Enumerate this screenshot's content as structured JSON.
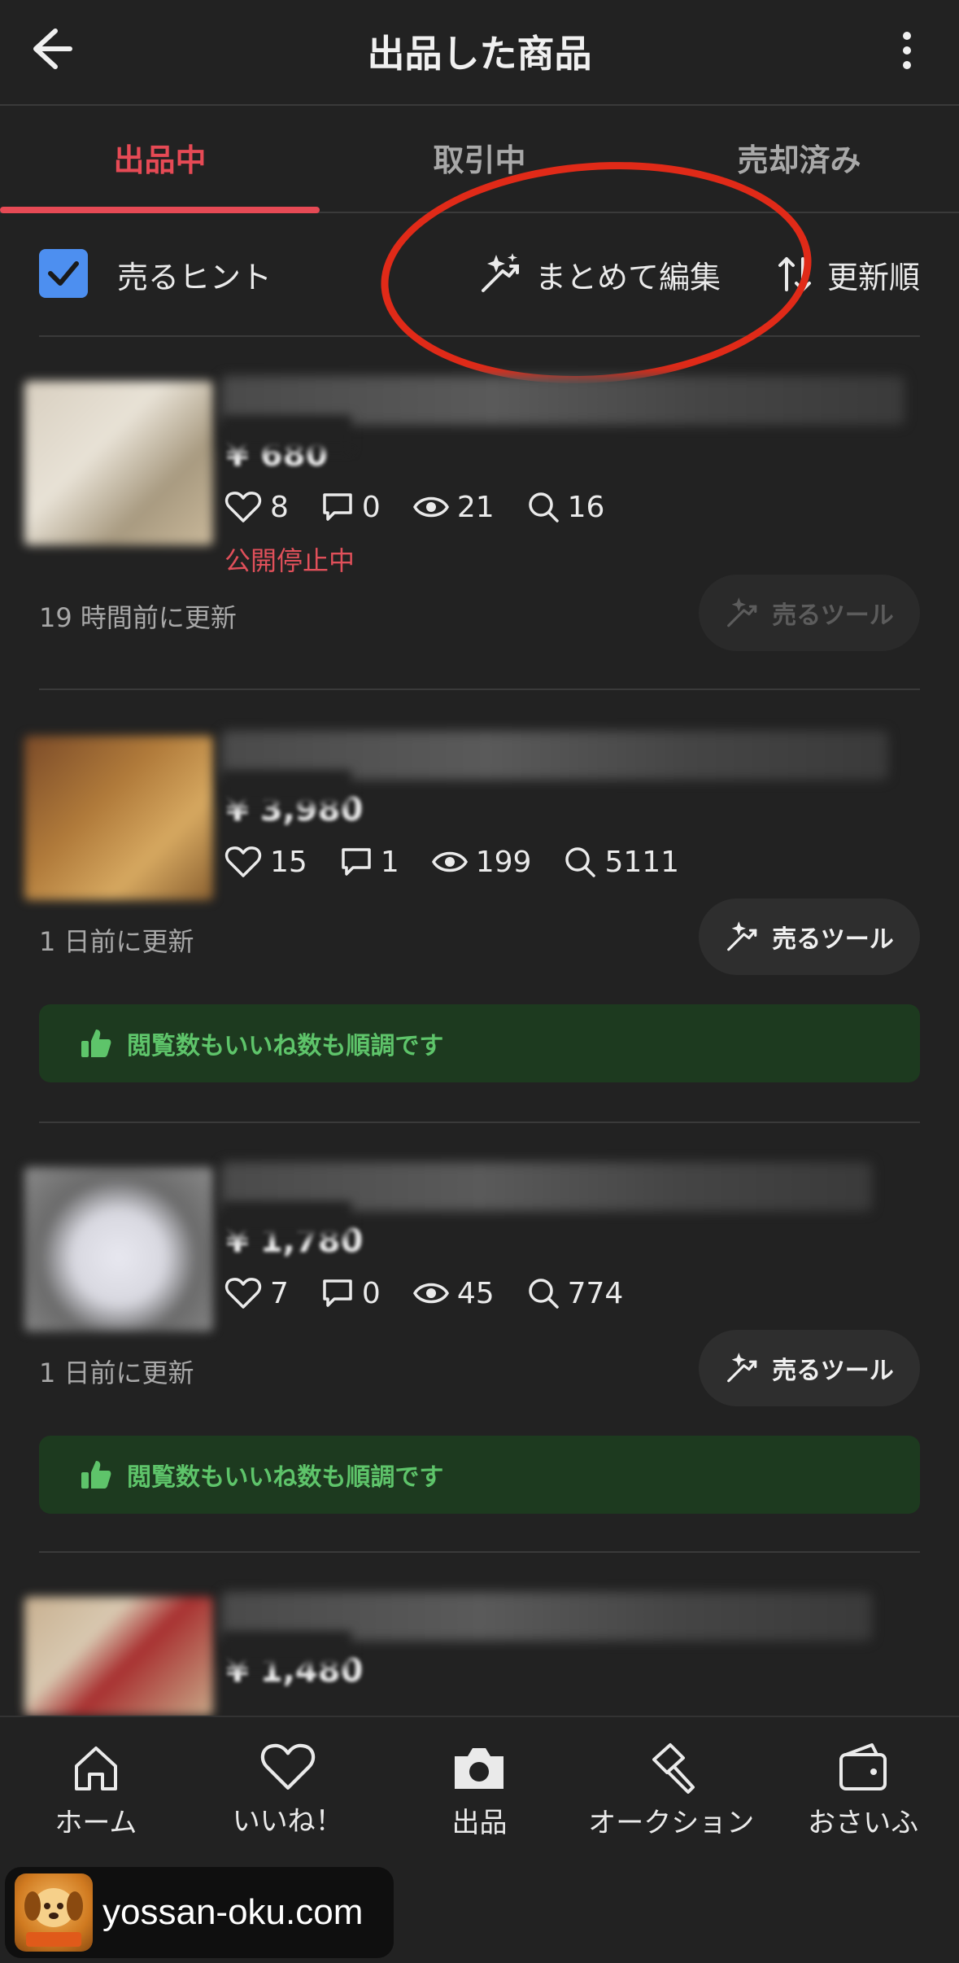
{
  "header": {
    "title": "出品した商品"
  },
  "tabs": [
    {
      "label": "出品中",
      "active": true
    },
    {
      "label": "取引中",
      "active": false
    },
    {
      "label": "売却済み",
      "active": false
    }
  ],
  "filters": {
    "hint_label": "売るヒント",
    "hint_checked": true,
    "bulk_edit_label": "まとめて編集",
    "sort_label": "更新順"
  },
  "items": [
    {
      "price": "¥ 680",
      "likes": "8",
      "comments": "0",
      "views": "21",
      "searches": "16",
      "status": "公開停止中",
      "updated": "19 時間前に更新",
      "tool_label": "売るツール",
      "tool_enabled": false,
      "banner": ""
    },
    {
      "price": "¥ 3,980",
      "likes": "15",
      "comments": "1",
      "views": "199",
      "searches": "5111",
      "status": "",
      "updated": "1 日前に更新",
      "tool_label": "売るツール",
      "tool_enabled": true,
      "banner": "閲覧数もいいね数も順調です"
    },
    {
      "price": "¥ 1,780",
      "likes": "7",
      "comments": "0",
      "views": "45",
      "searches": "774",
      "status": "",
      "updated": "1 日前に更新",
      "tool_label": "売るツール",
      "tool_enabled": true,
      "banner": "閲覧数もいいね数も順調です"
    },
    {
      "price": "¥ 1,480"
    }
  ],
  "bottom_nav": [
    {
      "label": "ホーム",
      "icon": "home-icon"
    },
    {
      "label": "いいね！",
      "icon": "heart-icon"
    },
    {
      "label": "出品",
      "icon": "camera-icon"
    },
    {
      "label": "オークション",
      "icon": "gavel-icon"
    },
    {
      "label": "おさいふ",
      "icon": "wallet-icon"
    }
  ],
  "watermark": {
    "text": "yossan-oku.com"
  },
  "colors": {
    "accent": "#e64a55",
    "checkbox": "#4d8ff0",
    "banner_bg": "#1d3a1f",
    "banner_text": "#5ec46a",
    "annotation": "#e02a18"
  }
}
